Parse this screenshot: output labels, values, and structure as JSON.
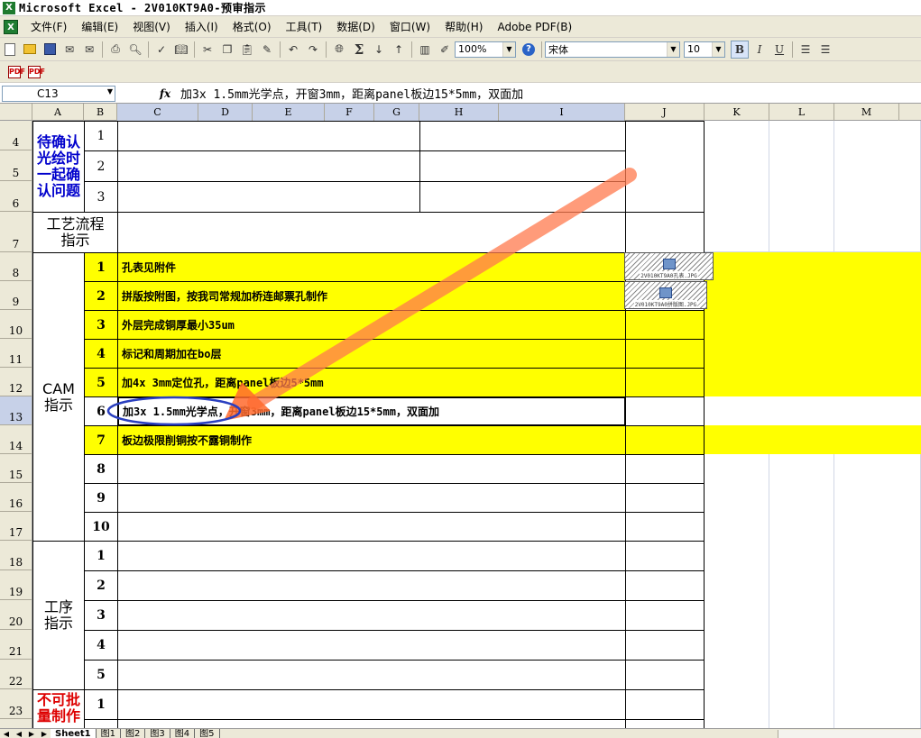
{
  "window": {
    "title": "Microsoft Excel - 2V010KT9A0-预审指示"
  },
  "menu": [
    "文件(F)",
    "编辑(E)",
    "视图(V)",
    "插入(I)",
    "格式(O)",
    "工具(T)",
    "数据(D)",
    "窗口(W)",
    "帮助(H)",
    "Adobe PDF(B)"
  ],
  "toolbar": {
    "zoom": "100%",
    "font": "宋体",
    "size": "10",
    "bold": "B",
    "italic": "I",
    "underline": "U",
    "sigma": "Σ",
    "help": "?"
  },
  "formula": {
    "cell_ref": "C13",
    "fx": "fx",
    "content": "加3x 1.5mm光学点，开窗3mm，距离panel板边15*5mm，双面加"
  },
  "columns": [
    "A",
    "B",
    "C",
    "D",
    "E",
    "F",
    "G",
    "H",
    "I",
    "J",
    "K",
    "L",
    "M"
  ],
  "rows": [
    "4",
    "5",
    "6",
    "7",
    "8",
    "9",
    "10",
    "11",
    "12",
    "13",
    "14",
    "15",
    "16",
    "17",
    "18",
    "19",
    "20",
    "21",
    "22",
    "23"
  ],
  "sections": {
    "confirm": "待确认光绘时一起确认问题",
    "process_flow": "工艺流程指示",
    "cam": "CAM指示",
    "procedure": "工序指示",
    "no_batch": "不可批量制作"
  },
  "confirm_nums": [
    "1",
    "2",
    "3"
  ],
  "cam_items": [
    {
      "num": "1",
      "text": "孔表见附件"
    },
    {
      "num": "2",
      "text": "拼版按附图，按我司常规加桥连邮票孔制作"
    },
    {
      "num": "3",
      "text": "外层完成铜厚最小35um"
    },
    {
      "num": "4",
      "text": "标记和周期加在bo层"
    },
    {
      "num": "5",
      "text": "加4x 3mm定位孔，距离panel板边5*5mm"
    },
    {
      "num": "6",
      "text": "加3x 1.5mm光学点，开窗3mm，距离panel板边15*5mm，双面加"
    },
    {
      "num": "7",
      "text": "板边极限削铜按不露铜制作"
    },
    {
      "num": "8",
      "text": ""
    },
    {
      "num": "9",
      "text": ""
    },
    {
      "num": "10",
      "text": ""
    }
  ],
  "procedure_nums": [
    "1",
    "2",
    "3",
    "4",
    "5"
  ],
  "no_batch_nums": [
    "1"
  ],
  "embedded_files": [
    "2V010KT9A0孔表.JPG",
    "2V010KT9A0拼版图.JPG"
  ],
  "sheet_tabs": [
    "Sheet1",
    "图1",
    "图2",
    "图3",
    "图4",
    "图5"
  ],
  "colors": {
    "highlight": "#ffff00",
    "header_bg": "#ece9d8",
    "selected_header": "#c7d1e8",
    "annotation_arrow": "#ff6a3d",
    "annotation_circle": "#2a3fbf"
  }
}
